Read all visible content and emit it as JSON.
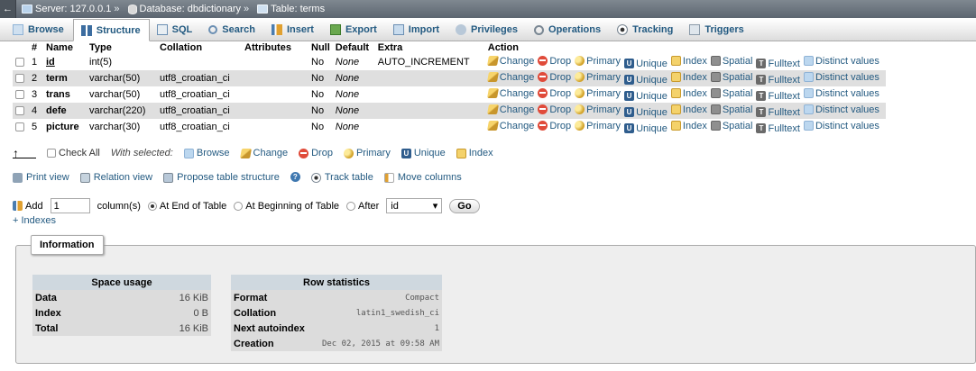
{
  "breadcrumb": {
    "server": "Server: 127.0.0.1",
    "database": "Database: dbdictionary",
    "table": "Table: terms"
  },
  "tabs": [
    {
      "label": "Browse",
      "icon": "browse-icon"
    },
    {
      "label": "Structure",
      "icon": "structure-icon"
    },
    {
      "label": "SQL",
      "icon": "sql-icon"
    },
    {
      "label": "Search",
      "icon": "search-icon"
    },
    {
      "label": "Insert",
      "icon": "insert-icon"
    },
    {
      "label": "Export",
      "icon": "export-icon"
    },
    {
      "label": "Import",
      "icon": "import-icon"
    },
    {
      "label": "Privileges",
      "icon": "privileges-icon"
    },
    {
      "label": "Operations",
      "icon": "operations-icon"
    },
    {
      "label": "Tracking",
      "icon": "tracking-icon"
    },
    {
      "label": "Triggers",
      "icon": "triggers-icon"
    }
  ],
  "structure": {
    "headers": {
      "num": "#",
      "name": "Name",
      "type": "Type",
      "collation": "Collation",
      "attributes": "Attributes",
      "null": "Null",
      "default": "Default",
      "extra": "Extra",
      "action": "Action"
    },
    "rows": [
      {
        "num": "1",
        "name": "id",
        "type": "int(5)",
        "collation": "",
        "attributes": "",
        "null": "No",
        "default": "None",
        "extra": "AUTO_INCREMENT"
      },
      {
        "num": "2",
        "name": "term",
        "type": "varchar(50)",
        "collation": "utf8_croatian_ci",
        "attributes": "",
        "null": "No",
        "default": "None",
        "extra": ""
      },
      {
        "num": "3",
        "name": "trans",
        "type": "varchar(50)",
        "collation": "utf8_croatian_ci",
        "attributes": "",
        "null": "No",
        "default": "None",
        "extra": ""
      },
      {
        "num": "4",
        "name": "defe",
        "type": "varchar(220)",
        "collation": "utf8_croatian_ci",
        "attributes": "",
        "null": "No",
        "default": "None",
        "extra": ""
      },
      {
        "num": "5",
        "name": "picture",
        "type": "varchar(30)",
        "collation": "utf8_croatian_ci",
        "attributes": "",
        "null": "No",
        "default": "None",
        "extra": ""
      }
    ],
    "actions": {
      "change": "Change",
      "drop": "Drop",
      "primary": "Primary",
      "unique": "Unique",
      "index": "Index",
      "spatial": "Spatial",
      "fulltext": "Fulltext",
      "distinct": "Distinct values"
    }
  },
  "with_selected": {
    "check_all": "Check All",
    "label": "With selected:",
    "browse": "Browse",
    "change": "Change",
    "drop": "Drop",
    "primary": "Primary",
    "unique": "Unique",
    "index": "Index"
  },
  "links": {
    "print_view": "Print view",
    "relation_view": "Relation view",
    "propose": "Propose table structure",
    "track_table": "Track table",
    "move_columns": "Move columns"
  },
  "add_columns": {
    "label": "Add",
    "count": "1",
    "columns_text": "column(s)",
    "at_end": "At End of Table",
    "at_beginning": "At Beginning of Table",
    "after": "After",
    "after_field": "id",
    "go": "Go"
  },
  "indexes_link": "+ Indexes",
  "information": {
    "legend": "Information",
    "space_usage": {
      "title": "Space usage",
      "rows": [
        {
          "label": "Data",
          "value": "16 KiB"
        },
        {
          "label": "Index",
          "value": "0 B"
        },
        {
          "label": "Total",
          "value": "16 KiB"
        }
      ]
    },
    "row_statistics": {
      "title": "Row statistics",
      "rows": [
        {
          "label": "Format",
          "value": "Compact"
        },
        {
          "label": "Collation",
          "value": "latin1_swedish_ci"
        },
        {
          "label": "Next autoindex",
          "value": "1"
        },
        {
          "label": "Creation",
          "value": "Dec 02, 2015 at 09:58 AM"
        }
      ]
    }
  }
}
